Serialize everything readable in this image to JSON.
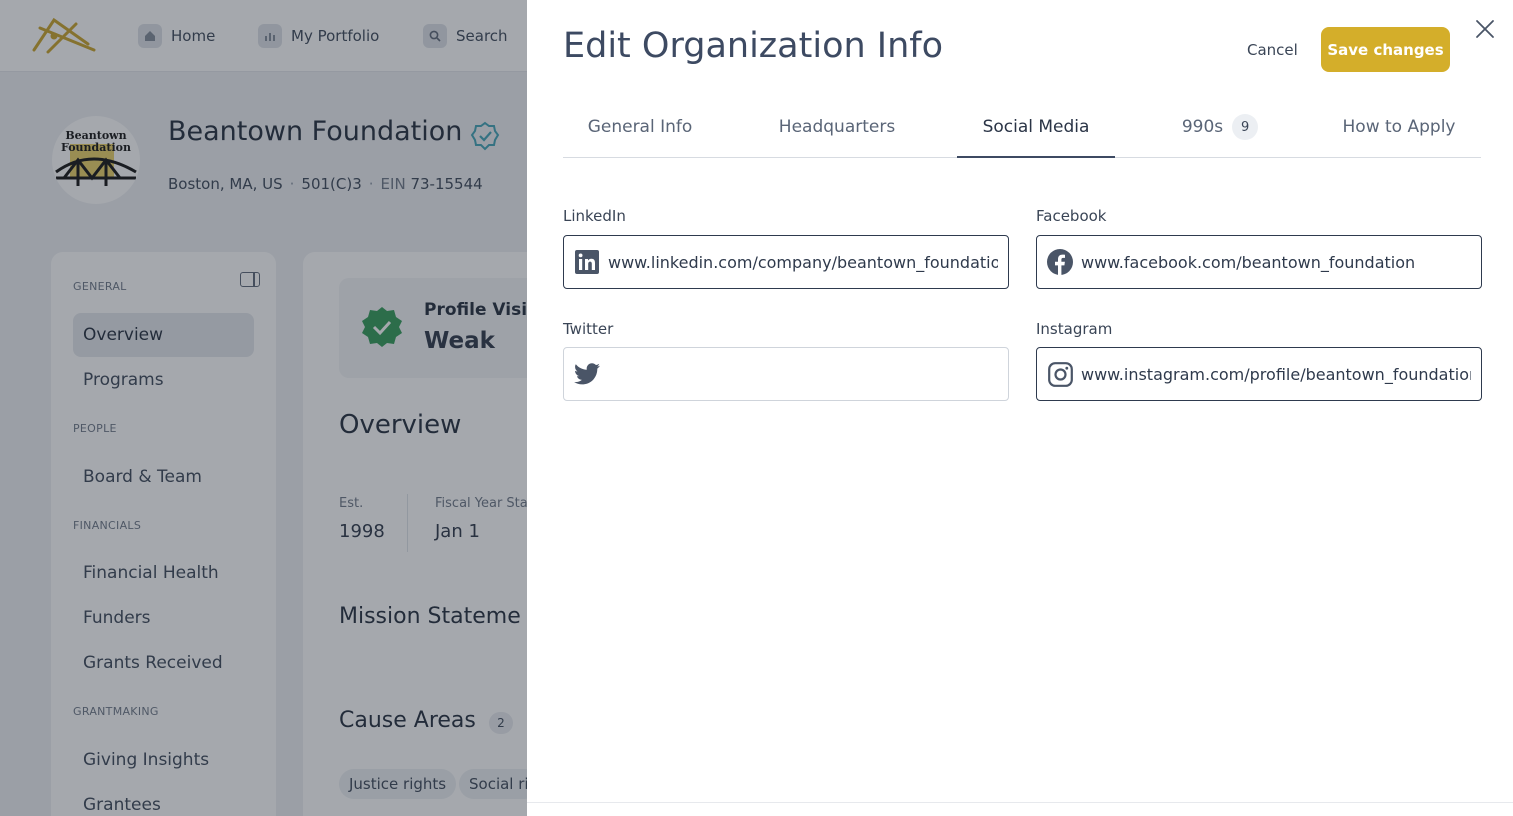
{
  "nav": {
    "home": "Home",
    "portfolio": "My Portfolio",
    "search": "Search"
  },
  "org": {
    "avatar_text_line1": "Beantown",
    "avatar_text_line2": "Foundation",
    "name": "Beantown Foundation",
    "location": "Boston, MA, US",
    "type": "501(C)3",
    "ein_label": "EIN",
    "ein": "73-15544"
  },
  "sidebar": {
    "sections": {
      "general": "GENERAL",
      "people": "PEOPLE",
      "financials": "FINANCIALS",
      "grantmaking": "GRANTMAKING"
    },
    "items": {
      "overview": "Overview",
      "programs": "Programs",
      "board": "Board & Team",
      "financial_health": "Financial Health",
      "funders": "Funders",
      "grants_received": "Grants Received",
      "giving_insights": "Giving Insights",
      "grantees": "Grantees"
    }
  },
  "main": {
    "visibility_title": "Profile Visib",
    "visibility_value": "Weak",
    "overview_heading": "Overview",
    "est_label": "Est.",
    "est_value": "1998",
    "fiscal_label": "Fiscal Year Sta",
    "fiscal_value": "Jan 1",
    "mission_heading": "Mission Stateme",
    "cause_heading": "Cause Areas",
    "cause_count": "2",
    "tags": [
      "Justice rights",
      "Social ri"
    ]
  },
  "drawer": {
    "title": "Edit Organization Info",
    "cancel_label": "Cancel",
    "save_label": "Save changes",
    "tabs": {
      "general": "General Info",
      "headquarters": "Headquarters",
      "social": "Social Media",
      "forms990": "990s",
      "forms990_count": "9",
      "apply": "How to Apply"
    },
    "fields": {
      "linkedin_label": "LinkedIn",
      "linkedin_value": "www.linkedin.com/company/beantown_foundation",
      "facebook_label": "Facebook",
      "facebook_value": "www.facebook.com/beantown_foundation",
      "twitter_label": "Twitter",
      "twitter_value": "",
      "instagram_label": "Instagram",
      "instagram_value": "www.instagram.com/profile/beantown_foundation"
    }
  },
  "colors": {
    "accent": "#d4ae2a",
    "verified": "#3fa3b5",
    "badge_green": "#2f9a55",
    "text_primary": "#3d4a62"
  }
}
